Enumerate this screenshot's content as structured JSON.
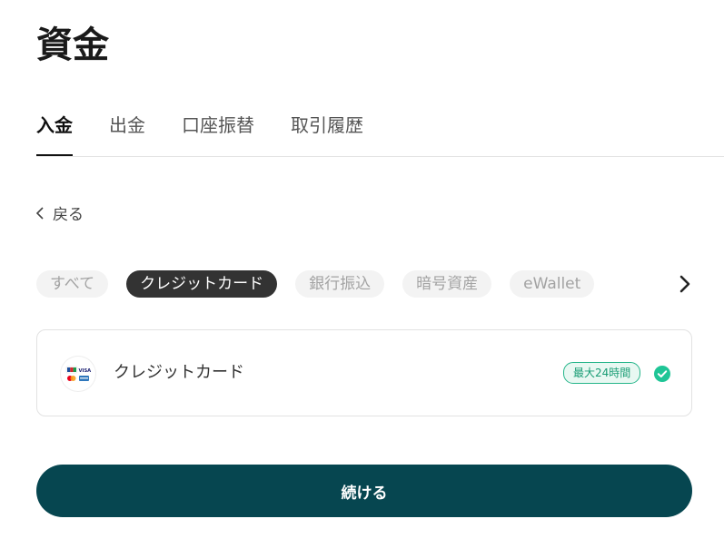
{
  "header": {
    "title": "資金"
  },
  "tabs": [
    {
      "label": "入金",
      "active": true
    },
    {
      "label": "出金",
      "active": false
    },
    {
      "label": "口座振替",
      "active": false
    },
    {
      "label": "取引履歴",
      "active": false
    }
  ],
  "back": {
    "label": "戻る"
  },
  "filters": [
    {
      "label": "すべて",
      "active": false
    },
    {
      "label": "クレジットカード",
      "active": true
    },
    {
      "label": "銀行振込",
      "active": false
    },
    {
      "label": "暗号資産",
      "active": false
    },
    {
      "label": "eWallet",
      "active": false
    }
  ],
  "method": {
    "name": "クレジットカード",
    "badge": "最大24時間",
    "selected": true,
    "logo_text": [
      "JCB",
      "VISA"
    ]
  },
  "actions": {
    "continue_label": "続ける"
  },
  "colors": {
    "primary": "#064650",
    "accent": "#25b58a",
    "chip_active": "#333333"
  },
  "icons": {
    "back": "chevron-left-icon",
    "next": "chevron-right-icon",
    "selected": "check-circle-icon",
    "card": "card-brands-icon"
  }
}
